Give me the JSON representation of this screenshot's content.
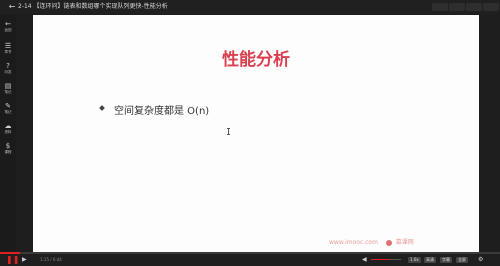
{
  "window": {
    "title": "2-14 【连环问】链表和数组哪个实现队列更快-性能分析"
  },
  "sidebar": {
    "items": [
      {
        "icon": "arrow-left-icon",
        "glyph": "←",
        "label": "返回"
      },
      {
        "icon": "list-icon",
        "glyph": "☰",
        "label": "章节"
      },
      {
        "icon": "question-icon",
        "glyph": "?",
        "label": "问答"
      },
      {
        "icon": "notes-icon",
        "glyph": "▤",
        "label": "笔记"
      },
      {
        "icon": "pen-icon",
        "glyph": "✎",
        "label": "笔记"
      },
      {
        "icon": "cloud-icon",
        "glyph": "☁",
        "label": "资料"
      },
      {
        "icon": "dollar-icon",
        "glyph": "$",
        "label": "课程"
      }
    ]
  },
  "slide": {
    "title": "性能分析",
    "bullet": "空间复杂度都是 O(n)"
  },
  "watermark": {
    "url": "www.imooc.com",
    "brand": "慕课网"
  },
  "player": {
    "progress": 0.04,
    "volume": 0.6,
    "time": "1:15 / 6:44",
    "buttons": [
      "1.0x",
      "高清",
      "字幕",
      "全屏"
    ]
  }
}
